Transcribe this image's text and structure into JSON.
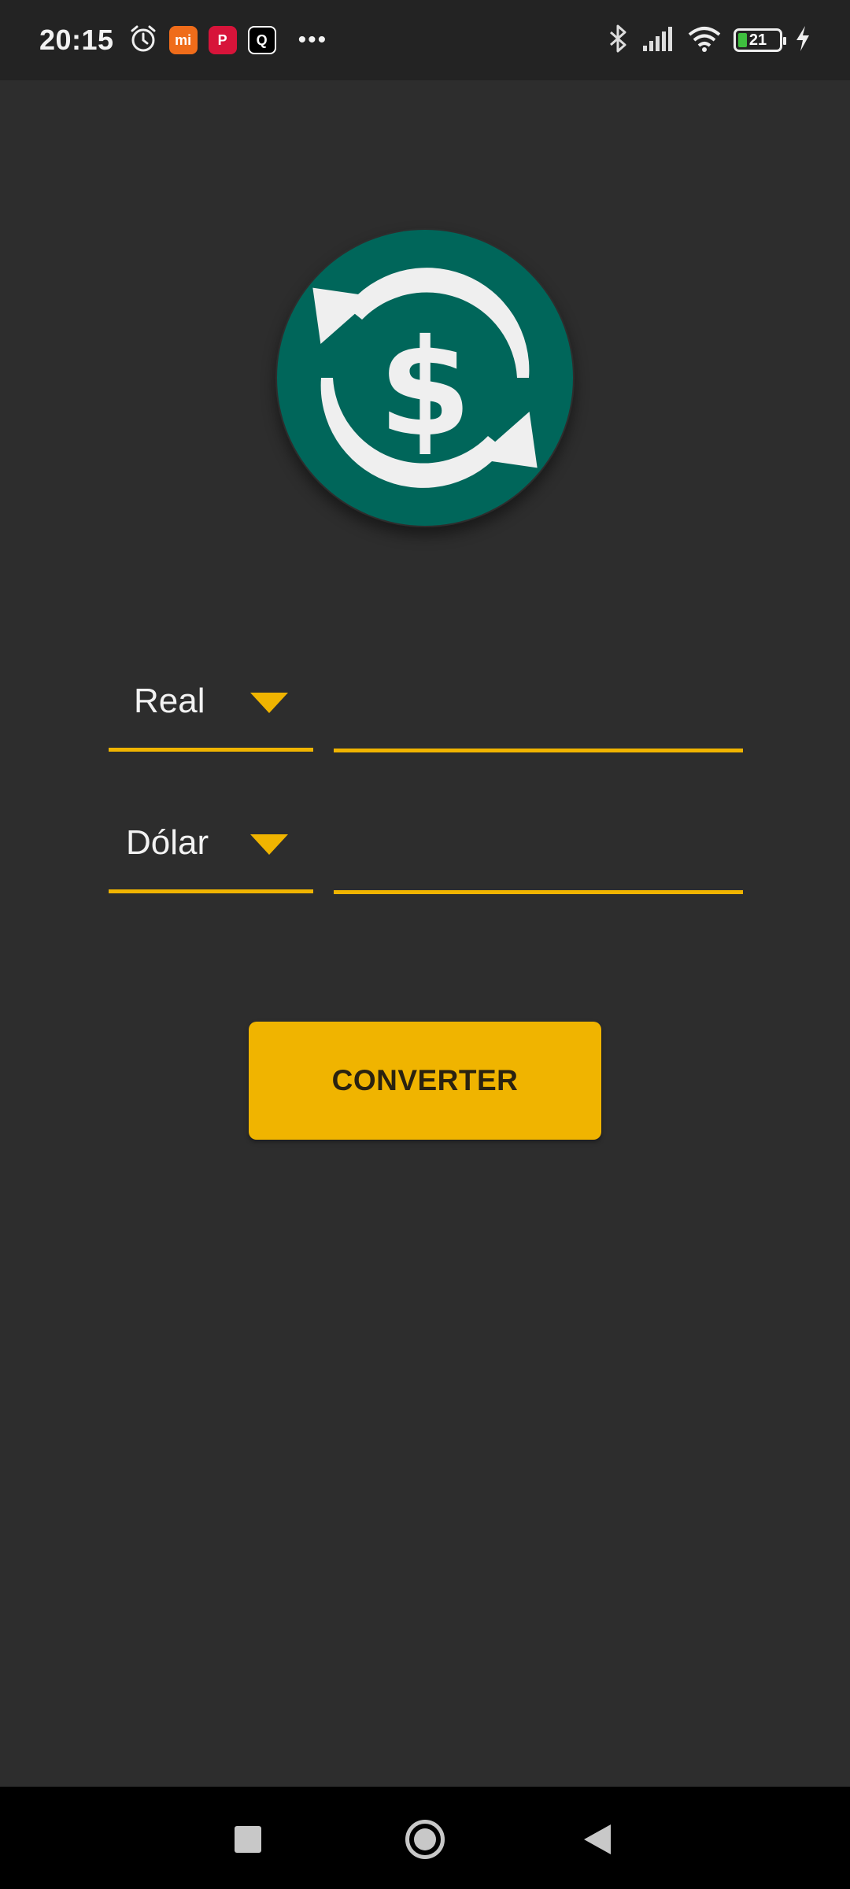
{
  "status_bar": {
    "time": "20:15",
    "notification_icons": [
      "alarm-icon",
      "mi-store-icon",
      "pinterest-icon",
      "app-icon"
    ],
    "mi_label": "mi",
    "pinterest_label": "P",
    "app_label": "Q",
    "more_label": "•••",
    "battery_level": "21",
    "icons": [
      "bluetooth-icon",
      "signal-icon",
      "wifi-icon",
      "battery-icon",
      "charging-icon"
    ]
  },
  "converter": {
    "from_currency": "Real",
    "to_currency": "Dólar",
    "from_amount": "",
    "to_amount": "",
    "convert_label": "CONVERTER"
  },
  "colors": {
    "background": "#2d2d2d",
    "accent": "#f0b400",
    "logo_green": "#00665a",
    "text": "#f2f2f2"
  },
  "nav_bar": {
    "icons": [
      "recents-icon",
      "home-icon",
      "back-icon"
    ]
  }
}
